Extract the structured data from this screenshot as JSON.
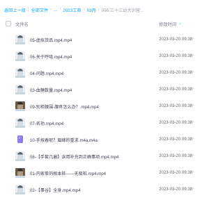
{
  "breadcrumb": {
    "back": "返回上一级",
    "items": [
      "全部文件",
      "...",
      "2023工商",
      "03月",
      "056.三十三幼大训营..."
    ]
  },
  "header": {
    "name_label": "文件名",
    "time_label": "修改时间",
    "sort_icon": "sort-down-arrow-icon"
  },
  "files": [
    {
      "name": "05-虚拟货品.mp4.mp4",
      "time": "2023-03-20 09:38",
      "icon": "video-thumb"
    },
    {
      "name": "06-关于呼吸.mp4.mp4",
      "time": "2023-03-20 09:38",
      "icon": "video-thumb"
    },
    {
      "name": "04-问题.mp4.mp4",
      "time": "2023-03-20 09:38",
      "icon": "video-thumb"
    },
    {
      "name": "03-血糖数量.mp4.mp4",
      "time": "2023-03-20 09:38",
      "icon": "video-thumb"
    },
    {
      "name": "09-别担腰围-腰疼怎么办？.mp4.mp4",
      "time": "2023-03-20 09:38",
      "icon": "video-thumb-dark"
    },
    {
      "name": "07-名功.mp4.mp4",
      "time": "2023-03-20 09:38",
      "icon": "video-thumb"
    },
    {
      "name": "10-手按着呢？眉峰的重求.m4a.m4a",
      "time": "2023-03-20 09:38",
      "icon": "audio-file-icon"
    },
    {
      "name": "08-【手套几遍】诶用补充到正确事项.mp4.mp4",
      "time": "2023-03-20 09:38",
      "icon": "video-thumb"
    },
    {
      "name": "01-内家拳的根本桩——无极桩.mp4.mp4",
      "time": "2023-03-20 09:38",
      "icon": "video-thumb-dark"
    },
    {
      "name": "02-【事谷】全身.mp4.mp4",
      "time": "2023-03-20 09:38",
      "icon": "video-thumb"
    }
  ]
}
